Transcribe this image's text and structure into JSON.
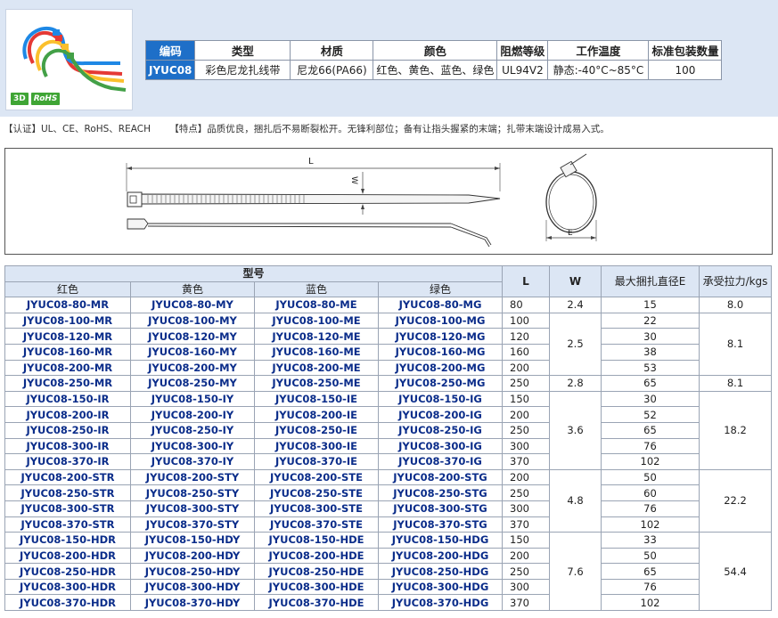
{
  "spec": {
    "headers": [
      "编码",
      "类型",
      "材质",
      "颜色",
      "阻燃等级",
      "工作温度",
      "标准包装数量"
    ],
    "values": [
      "JYUC08",
      "彩色尼龙扎线带",
      "尼龙66(PA66)",
      "红色、黄色、蓝色、绿色",
      "UL94V2",
      "静态:-40°C~85°C",
      "100"
    ]
  },
  "badges": {
    "d3": "3D",
    "rohs": "RoHS"
  },
  "notes": {
    "cert": "【认证】UL、CE、RoHS、REACH",
    "feature": "【特点】品质优良，捆扎后不易断裂松开。无锋利部位；备有让指头握紧的末端；扎带末端设计成易入式。"
  },
  "drawing": {
    "L": "L",
    "W": "W",
    "E": "E"
  },
  "table": {
    "group_header": "型号",
    "color_headers": [
      "红色",
      "黄色",
      "蓝色",
      "绿色"
    ],
    "col_L": "L",
    "col_W": "W",
    "col_E": "最大捆扎直径E",
    "col_F": "承受拉力/kgs",
    "rows": [
      {
        "r": "JYUC08-80-MR",
        "y": "JYUC08-80-MY",
        "b": "JYUC08-80-ME",
        "g": "JYUC08-80-MG",
        "L": "80",
        "E": "15"
      },
      {
        "r": "JYUC08-100-MR",
        "y": "JYUC08-100-MY",
        "b": "JYUC08-100-ME",
        "g": "JYUC08-100-MG",
        "L": "100",
        "E": "22"
      },
      {
        "r": "JYUC08-120-MR",
        "y": "JYUC08-120-MY",
        "b": "JYUC08-120-ME",
        "g": "JYUC08-120-MG",
        "L": "120",
        "E": "30"
      },
      {
        "r": "JYUC08-160-MR",
        "y": "JYUC08-160-MY",
        "b": "JYUC08-160-ME",
        "g": "JYUC08-160-MG",
        "L": "160",
        "E": "38"
      },
      {
        "r": "JYUC08-200-MR",
        "y": "JYUC08-200-MY",
        "b": "JYUC08-200-ME",
        "g": "JYUC08-200-MG",
        "L": "200",
        "E": "53"
      },
      {
        "r": "JYUC08-250-MR",
        "y": "JYUC08-250-MY",
        "b": "JYUC08-250-ME",
        "g": "JYUC08-250-MG",
        "L": "250",
        "E": "65"
      },
      {
        "r": "JYUC08-150-IR",
        "y": "JYUC08-150-IY",
        "b": "JYUC08-150-IE",
        "g": "JYUC08-150-IG",
        "L": "150",
        "E": "30"
      },
      {
        "r": "JYUC08-200-IR",
        "y": "JYUC08-200-IY",
        "b": "JYUC08-200-IE",
        "g": "JYUC08-200-IG",
        "L": "200",
        "E": "52"
      },
      {
        "r": "JYUC08-250-IR",
        "y": "JYUC08-250-IY",
        "b": "JYUC08-250-IE",
        "g": "JYUC08-250-IG",
        "L": "250",
        "E": "65"
      },
      {
        "r": "JYUC08-300-IR",
        "y": "JYUC08-300-IY",
        "b": "JYUC08-300-IE",
        "g": "JYUC08-300-IG",
        "L": "300",
        "E": "76"
      },
      {
        "r": "JYUC08-370-IR",
        "y": "JYUC08-370-IY",
        "b": "JYUC08-370-IE",
        "g": "JYUC08-370-IG",
        "L": "370",
        "E": "102"
      },
      {
        "r": "JYUC08-200-STR",
        "y": "JYUC08-200-STY",
        "b": "JYUC08-200-STE",
        "g": "JYUC08-200-STG",
        "L": "200",
        "E": "50"
      },
      {
        "r": "JYUC08-250-STR",
        "y": "JYUC08-250-STY",
        "b": "JYUC08-250-STE",
        "g": "JYUC08-250-STG",
        "L": "250",
        "E": "60"
      },
      {
        "r": "JYUC08-300-STR",
        "y": "JYUC08-300-STY",
        "b": "JYUC08-300-STE",
        "g": "JYUC08-300-STG",
        "L": "300",
        "E": "76"
      },
      {
        "r": "JYUC08-370-STR",
        "y": "JYUC08-370-STY",
        "b": "JYUC08-370-STE",
        "g": "JYUC08-370-STG",
        "L": "370",
        "E": "102"
      },
      {
        "r": "JYUC08-150-HDR",
        "y": "JYUC08-150-HDY",
        "b": "JYUC08-150-HDE",
        "g": "JYUC08-150-HDG",
        "L": "150",
        "E": "33"
      },
      {
        "r": "JYUC08-200-HDR",
        "y": "JYUC08-200-HDY",
        "b": "JYUC08-200-HDE",
        "g": "JYUC08-200-HDG",
        "L": "200",
        "E": "50"
      },
      {
        "r": "JYUC08-250-HDR",
        "y": "JYUC08-250-HDY",
        "b": "JYUC08-250-HDE",
        "g": "JYUC08-250-HDG",
        "L": "250",
        "E": "65"
      },
      {
        "r": "JYUC08-300-HDR",
        "y": "JYUC08-300-HDY",
        "b": "JYUC08-300-HDE",
        "g": "JYUC08-300-HDG",
        "L": "300",
        "E": "76"
      },
      {
        "r": "JYUC08-370-HDR",
        "y": "JYUC08-370-HDY",
        "b": "JYUC08-370-HDE",
        "g": "JYUC08-370-HDG",
        "L": "370",
        "E": "102"
      }
    ],
    "W_groups": [
      {
        "start": 0,
        "span": 1,
        "value": "2.4"
      },
      {
        "start": 1,
        "span": 4,
        "value": "2.5"
      },
      {
        "start": 5,
        "span": 1,
        "value": "2.8"
      },
      {
        "start": 6,
        "span": 5,
        "value": "3.6"
      },
      {
        "start": 11,
        "span": 4,
        "value": "4.8"
      },
      {
        "start": 15,
        "span": 5,
        "value": "7.6"
      }
    ],
    "F_groups": [
      {
        "start": 0,
        "span": 1,
        "value": "8.0"
      },
      {
        "start": 1,
        "span": 4,
        "value": "8.1"
      },
      {
        "start": 5,
        "span": 1,
        "value": "8.1"
      },
      {
        "start": 6,
        "span": 5,
        "value": "18.2"
      },
      {
        "start": 11,
        "span": 4,
        "value": "22.2"
      },
      {
        "start": 15,
        "span": 5,
        "value": "54.4"
      }
    ]
  },
  "colors": {
    "code_blue": "#1e6fc8",
    "header_band": "#dce6f4",
    "part_number": "#0b2d8a"
  }
}
